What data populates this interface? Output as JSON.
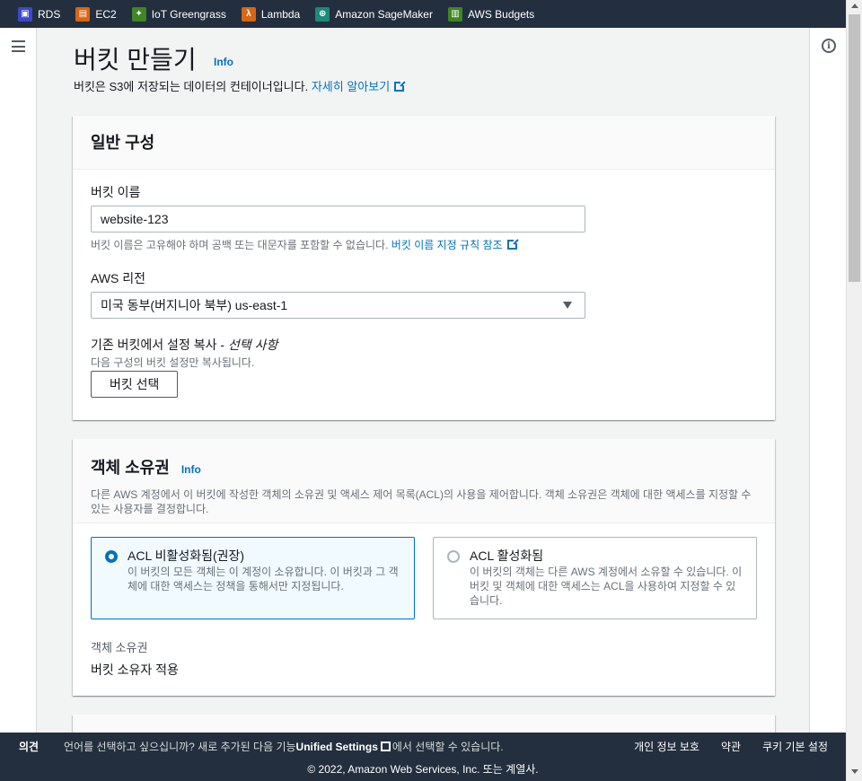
{
  "services": [
    {
      "label": "RDS",
      "icon": "rds-icon",
      "color": "#3b48cc"
    },
    {
      "label": "EC2",
      "icon": "ec2-icon",
      "color": "#d86613"
    },
    {
      "label": "IoT Greengrass",
      "icon": "iot-greengrass-icon",
      "color": "#3f8624"
    },
    {
      "label": "Lambda",
      "icon": "lambda-icon",
      "color": "#d86613"
    },
    {
      "label": "Amazon SageMaker",
      "icon": "sagemaker-icon",
      "color": "#1b8a7a"
    },
    {
      "label": "AWS Budgets",
      "icon": "budgets-icon",
      "color": "#3f8624"
    }
  ],
  "page": {
    "title": "버킷 만들기",
    "info": "Info",
    "description": "버킷은 S3에 저장되는 데이터의 컨테이너입니다.",
    "learn_more": "자세히 알아보기"
  },
  "general": {
    "title": "일반 구성",
    "bucket_name_label": "버킷 이름",
    "bucket_name_value": "website-123",
    "bucket_name_hint": "버킷 이름은 고유해야 하며 공백 또는 대문자를 포함할 수 없습니다.",
    "naming_rules_link": "버킷 이름 지정 규칙 참조",
    "region_label": "AWS 리전",
    "region_value": "미국 동부(버지니아 북부) us-east-1",
    "copy_label": "기존 버킷에서 설정 복사 - ",
    "copy_optional": "선택 사항",
    "copy_hint": "다음 구성의 버킷 설정만 복사됩니다.",
    "choose_bucket_button": "버킷 선택"
  },
  "ownership": {
    "title": "객체 소유권",
    "info": "Info",
    "description": "다른 AWS 계정에서 이 버킷에 작성한 객체의 소유권 및 액세스 제어 목록(ACL)의 사용을 제어합니다. 객체 소유권은 객체에 대한 액세스를 지정할 수 있는 사용자를 결정합니다.",
    "option_disabled_title": "ACL 비활성화됨(권장)",
    "option_disabled_desc": "이 버킷의 모든 객체는 이 계정이 소유합니다. 이 버킷과 그 객체에 대한 액세스는 정책을 통해서만 지정됩니다.",
    "option_enabled_title": "ACL 활성화됨",
    "option_enabled_desc": "이 버킷의 객체는 다른 AWS 계정에서 소유할 수 있습니다. 이 버킷 및 객체에 대한 액세스는 ACL을 사용하여 지정할 수 있습니다.",
    "selected": "disabled",
    "result_label": "객체 소유권",
    "result_value": "버킷 소유자 적용"
  },
  "footer": {
    "feedback": "의견",
    "lang_prefix": "언어를 선택하고 싶으십니까? 새로 추가된 다음 기능",
    "unified_settings": "Unified Settings",
    "lang_suffix": "에서 선택할 수 있습니다.",
    "privacy": "개인 정보 보호",
    "terms": "약관",
    "cookies": "쿠키 기본 설정",
    "copyright": "© 2022, Amazon Web Services, Inc. 또는 계열사."
  },
  "colors": {
    "nav_bg": "#232f3e",
    "link": "#0073bb",
    "selected_bg": "#f1faff"
  }
}
